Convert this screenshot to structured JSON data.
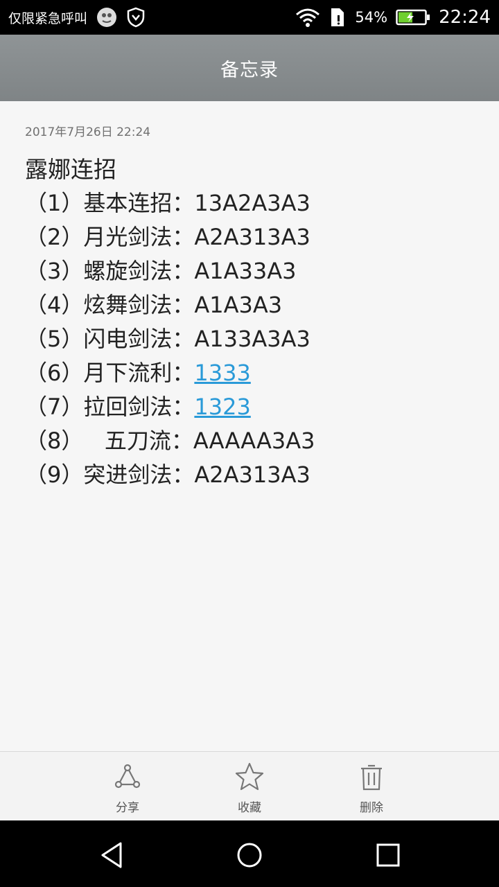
{
  "status_bar": {
    "carrier": "仅限紧急呼叫",
    "battery_percent": "54%",
    "battery_level": 0.54,
    "time": "22:24",
    "icons": [
      "notification-app-icon",
      "vpn-shield-icon",
      "wifi-icon",
      "sim-icon",
      "battery-icon"
    ]
  },
  "header": {
    "title": "备忘录"
  },
  "note": {
    "date": "2017年7月26日 22:24",
    "title": "露娜连招",
    "lines": [
      {
        "prefix": "（1）基本连招：",
        "combo": "13A2A3A3",
        "linked": false
      },
      {
        "prefix": "（2）月光剑法：",
        "combo": "A2A313A3",
        "linked": false
      },
      {
        "prefix": "（3）螺旋剑法：",
        "combo": "A1A33A3",
        "linked": false
      },
      {
        "prefix": "（4）炫舞剑法：",
        "combo": "A1A3A3",
        "linked": false
      },
      {
        "prefix": "（5）闪电剑法：",
        "combo": "A133A3A3",
        "linked": false
      },
      {
        "prefix": "（6）月下流利：",
        "combo": "1333",
        "linked": true
      },
      {
        "prefix": "（7）拉回剑法：",
        "combo": "1323",
        "linked": true
      },
      {
        "prefix": "（8）   五刀流：",
        "combo": "AAAAA3A3",
        "linked": false
      },
      {
        "prefix": "（9）突进剑法：",
        "combo": "A2A313A3",
        "linked": false
      }
    ]
  },
  "toolbar": {
    "share_label": "分享",
    "favorite_label": "收藏",
    "delete_label": "删除",
    "icons": [
      "share-icon",
      "star-icon",
      "trash-icon"
    ]
  },
  "nav": {
    "icons": [
      "back-icon",
      "home-icon",
      "recents-icon"
    ]
  },
  "colors": {
    "link": "#2a9ad8",
    "title_bar": "#888d8f",
    "battery_fill": "#6fcf2f"
  }
}
